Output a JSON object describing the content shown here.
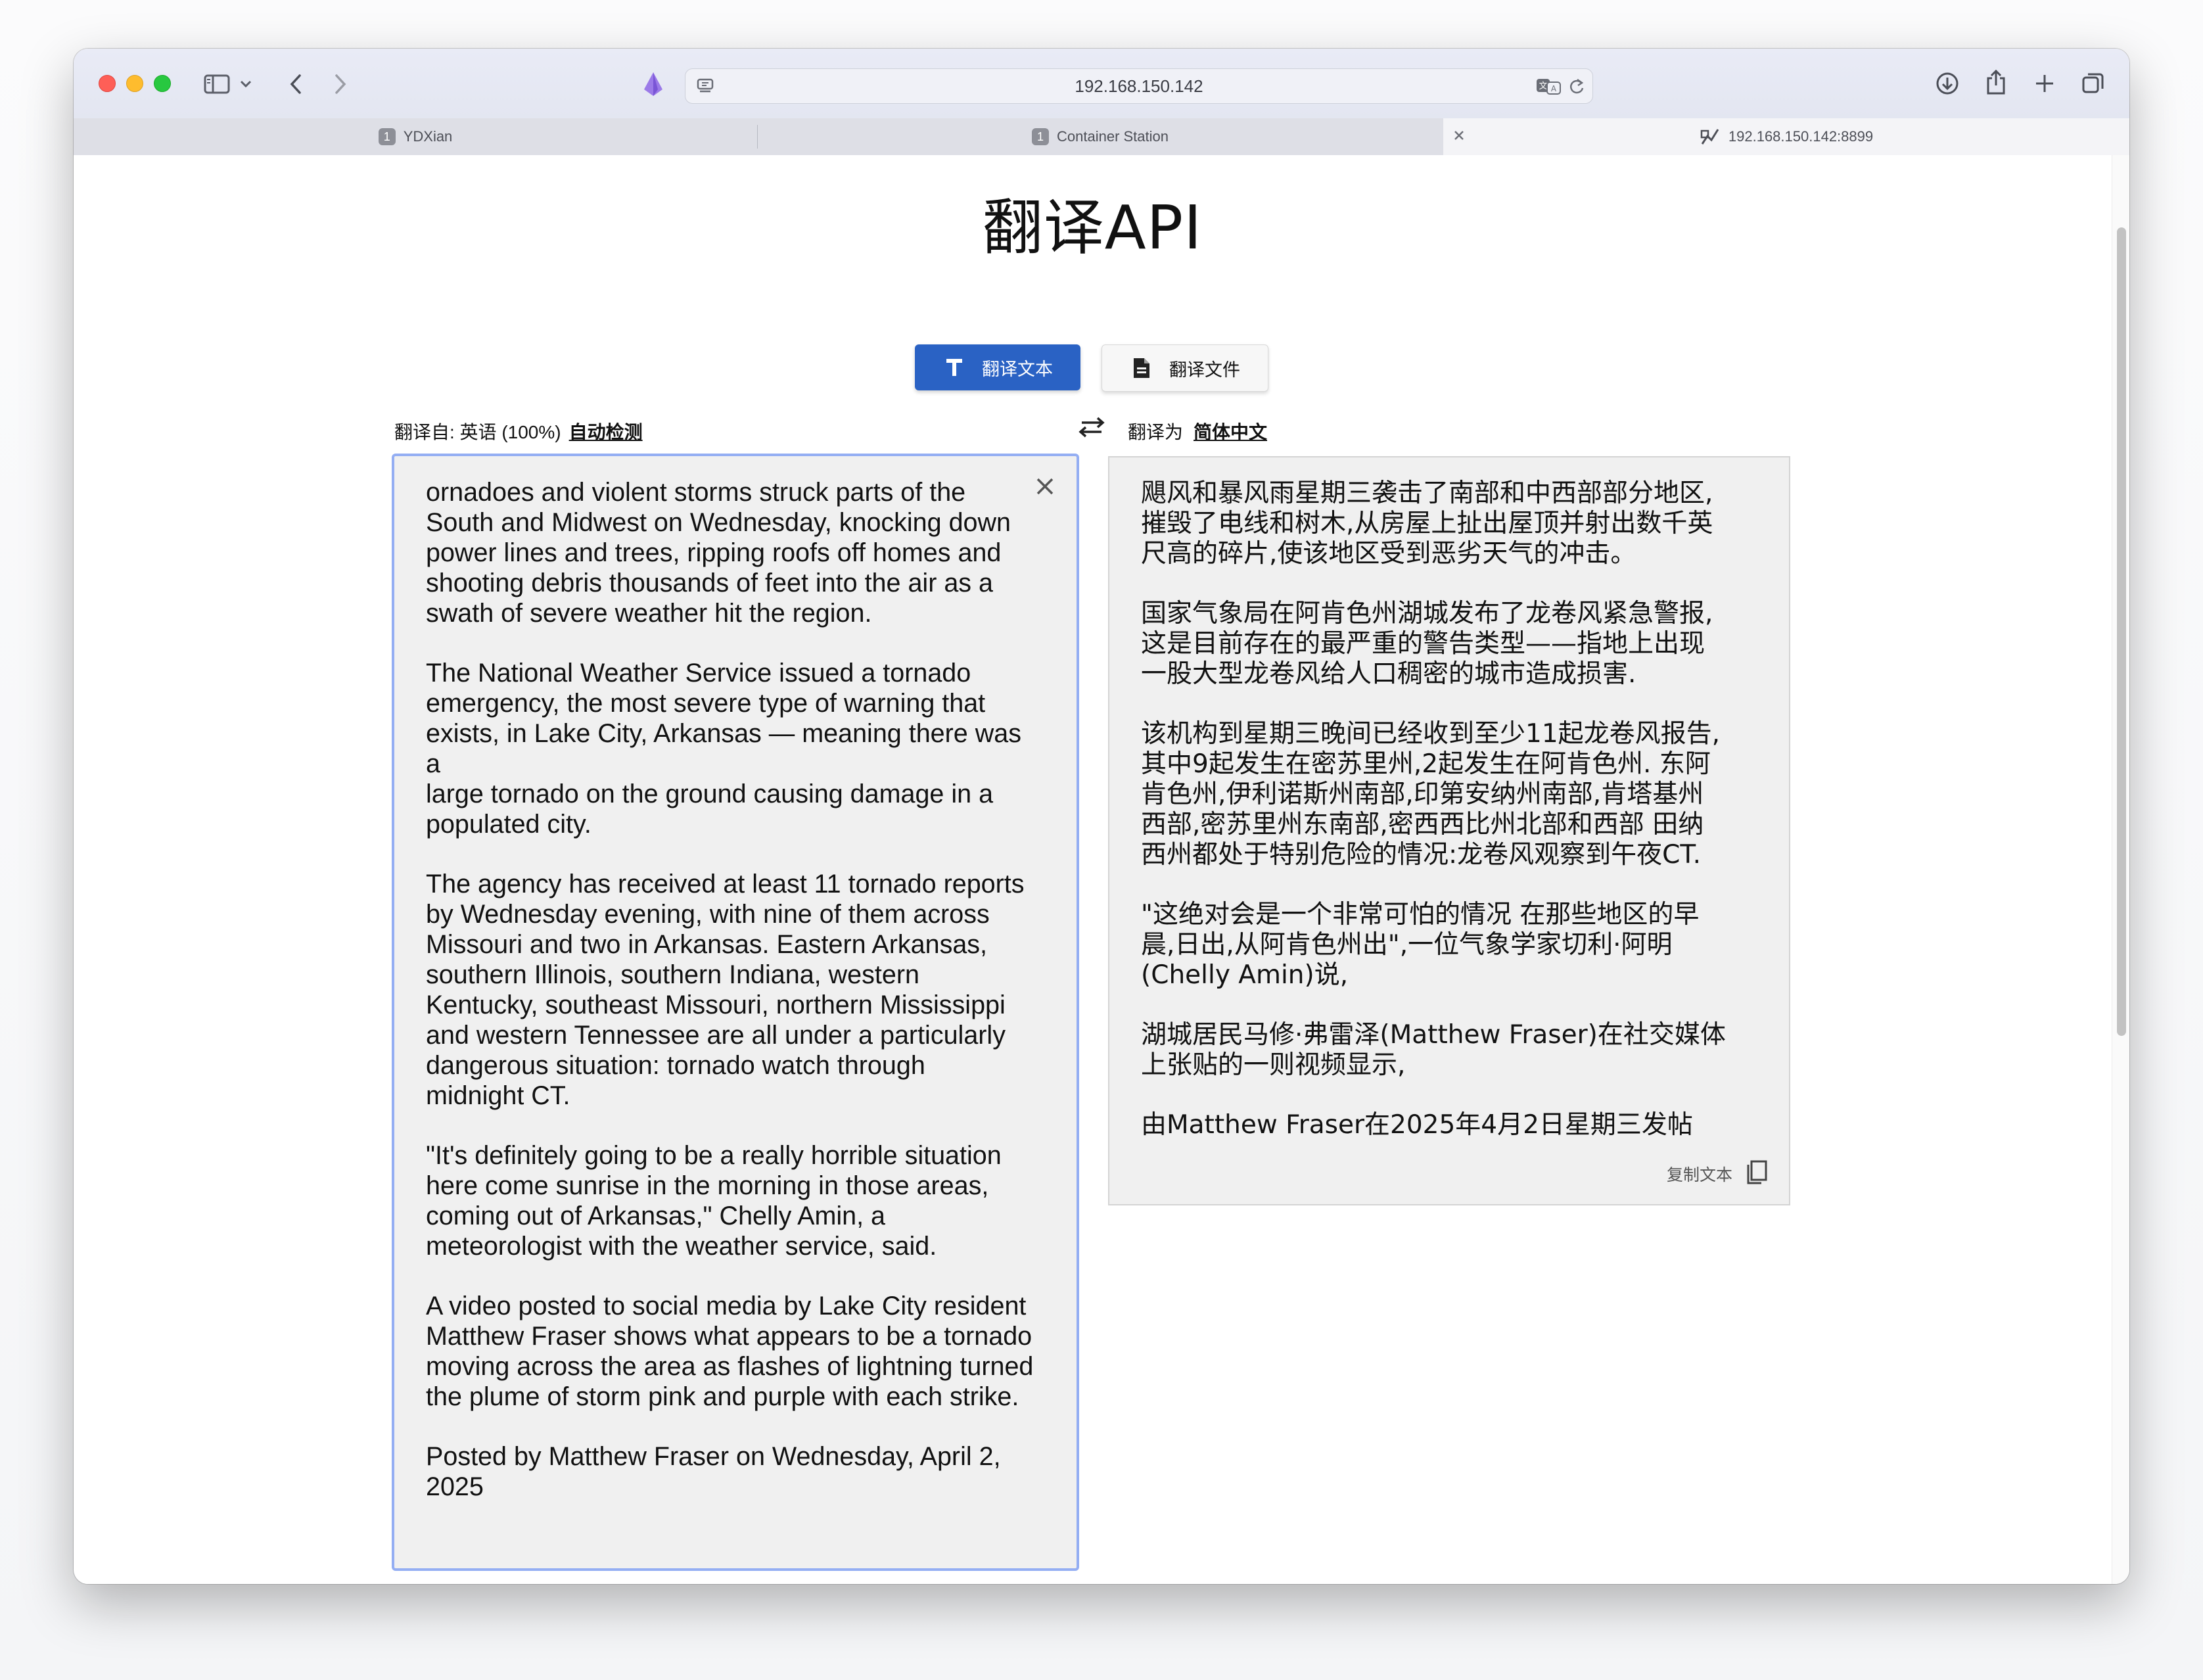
{
  "browser": {
    "address": "192.168.150.142",
    "tabs": [
      {
        "number": "1",
        "label": "YDXian"
      },
      {
        "number": "1",
        "label": "Container Station"
      },
      {
        "label": "192.168.150.142:8899"
      }
    ]
  },
  "page": {
    "title": "翻译API",
    "mode_buttons": {
      "text": "翻译文本",
      "file": "翻译文件"
    },
    "source_lang": {
      "prefix": "翻译自: 英语 (100%)",
      "link": "自动检测"
    },
    "target_lang": {
      "prefix": "翻译为",
      "link": "简体中文"
    },
    "source_paragraphs": [
      "ornadoes and violent storms struck parts of the\nSouth and Midwest on Wednesday, knocking down\npower lines and trees, ripping roofs off homes and\nshooting debris thousands of feet into the air as a\nswath of severe weather hit the region.",
      "The National Weather Service issued a tornado\nemergency, the most severe type of warning that\nexists, in Lake City, Arkansas — meaning there was a\nlarge tornado on the ground causing damage in a\npopulated city.",
      "The agency has received at least 11 tornado reports\nby Wednesday evening, with nine of them across\nMissouri and two in Arkansas. Eastern Arkansas,\nsouthern Illinois, southern Indiana, western\nKentucky, southeast Missouri, northern Mississippi\nand western Tennessee are all under a particularly\ndangerous situation: tornado watch through\nmidnight CT.",
      "\"It's definitely going to be a really horrible situation\nhere come sunrise in the morning in those areas,\ncoming out of Arkansas,\" Chelly Amin, a\nmeteorologist with the weather service, said.",
      "A video posted to social media by Lake City resident\nMatthew Fraser shows what appears to be a tornado\nmoving across the area as flashes of lightning turned\nthe plume of storm pink and purple with each strike.",
      "Posted by Matthew Fraser on Wednesday, April 2,\n2025"
    ],
    "target_paragraphs": [
      "飓风和暴风雨星期三袭击了南部和中西部部分地区,\n摧毁了电线和树木,从房屋上扯出屋顶并射出数千英\n尺高的碎片,使该地区受到恶劣天气的冲击。",
      "国家气象局在阿肯色州湖城发布了龙卷风紧急警报,\n这是目前存在的最严重的警告类型——指地上出现\n一股大型龙卷风给人口稠密的城市造成损害.",
      "该机构到星期三晚间已经收到至少11起龙卷风报告,\n其中9起发生在密苏里州,2起发生在阿肯色州. 东阿\n肯色州,伊利诺斯州南部,印第安纳州南部,肯塔基州\n西部,密苏里州东南部,密西西比州北部和西部 田纳\n西州都处于特别危险的情况:龙卷风观察到午夜CT.",
      "\"这绝对会是一个非常可怕的情况 在那些地区的早\n晨,日出,从阿肯色州出\",一位气象学家切利·阿明\n(Chelly Amin)说,",
      "湖城居民马修·弗雷泽(Matthew Fraser)在社交媒体\n上张贴的一则视频显示,",
      "由Matthew Fraser在2025年4月2日星期三发帖"
    ],
    "copy_label": "复制文本"
  },
  "colors": {
    "primary": "#2a62c4",
    "focus_border": "#94aef3"
  }
}
